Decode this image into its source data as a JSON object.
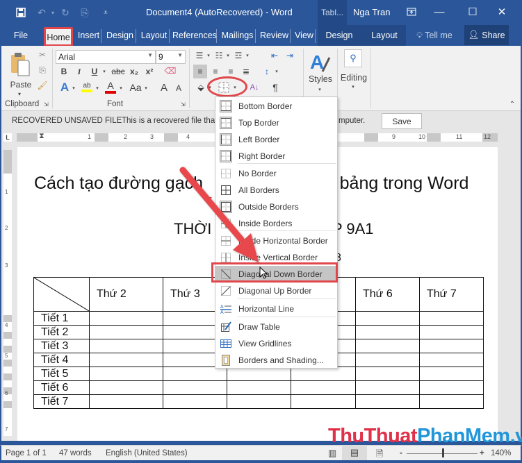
{
  "titlebar": {
    "title": "Document4 (AutoRecovered)  -  Word",
    "context_tab_title": "Tabl...",
    "user": "Nga Tran",
    "qat_icons": [
      "save-icon",
      "undo-icon",
      "redo-icon",
      "copy-icon",
      "customize-qat-icon"
    ],
    "window_buttons": [
      "ribbon-display-icon",
      "minimize-icon",
      "maximize-icon",
      "close-icon"
    ]
  },
  "tabs": {
    "items": [
      "File",
      "Home",
      "Insert",
      "Design",
      "Layout",
      "References",
      "Mailings",
      "Review",
      "View"
    ],
    "context_items": [
      "Design",
      "Layout"
    ],
    "tell_me": "Tell me",
    "share": "Share",
    "active": "Home"
  },
  "ribbon": {
    "clipboard": {
      "paste": "Paste",
      "label": "Clipboard"
    },
    "font": {
      "name": "Arial",
      "size": "9",
      "label": "Font",
      "bold": "B",
      "italic": "I",
      "underline": "U",
      "strike": "abc",
      "subscript": "x₂",
      "superscript": "x²",
      "change_case": "Aa",
      "grow": "A",
      "shrink": "A",
      "highlight_color": "#ffff00",
      "font_color": "#e00000"
    },
    "styles": {
      "label": "Styles"
    },
    "editing": {
      "label": "Editing"
    }
  },
  "message_bar": {
    "title": "RECOVERED UNSAVED FILE",
    "text_start": "This is a recovered file tha",
    "text_end": "mputer.",
    "save": "Save"
  },
  "ruler": {
    "labels": [
      "1",
      "2",
      "3",
      "4",
      "9",
      "10",
      "11",
      "12"
    ],
    "corner": "L",
    "vertical_labels": [
      "1",
      "2",
      "3",
      "4",
      "5",
      "6",
      "7"
    ]
  },
  "document": {
    "heading": "Cách tạo đường gạch                       qua bảng trong Word",
    "heading_left": "Cách tạo đường gạch",
    "heading_right": "qua bảng trong Word",
    "red_fragment": "T",
    "subheading_left": "THỜI",
    "subheading_right": "P 9A1",
    "line3_fragment": "8",
    "table": {
      "header": [
        "",
        "Thứ 2",
        "Thứ 3",
        "",
        "",
        "Thứ 6",
        "Thứ 7"
      ],
      "rows": [
        "Tiết 1",
        "Tiết 2",
        "Tiết 3",
        "Tiết 4",
        "Tiết 5",
        "Tiết 6",
        "Tiết 7"
      ]
    }
  },
  "borders_menu": {
    "items": [
      {
        "label": "Bottom Border",
        "icon": "bottom-border-icon",
        "active": true
      },
      {
        "label": "Top Border",
        "icon": "top-border-icon",
        "active": true
      },
      {
        "label": "Left Border",
        "icon": "left-border-icon",
        "active": true
      },
      {
        "label": "Right Border",
        "icon": "right-border-icon",
        "active": true
      },
      {
        "label": "No Border",
        "icon": "no-border-icon",
        "active": false
      },
      {
        "label": "All Borders",
        "icon": "all-borders-icon",
        "active": false
      },
      {
        "label": "Outside Borders",
        "icon": "outside-borders-icon",
        "active": true
      },
      {
        "label": "Inside Borders",
        "icon": "inside-borders-icon",
        "active": false
      },
      {
        "label": "Inside Horizontal Border",
        "icon": "inside-horizontal-border-icon",
        "active": false
      },
      {
        "label": "Inside Vertical Border",
        "icon": "inside-vertical-border-icon",
        "active": false
      },
      {
        "label": "Diagonal Down Border",
        "icon": "diagonal-down-border-icon",
        "active": false,
        "highlighted": true
      },
      {
        "label": "Diagonal Up Border",
        "icon": "diagonal-up-border-icon",
        "active": false
      },
      {
        "label": "Horizontal Line",
        "icon": "horizontal-line-icon",
        "active": false
      },
      {
        "label": "Draw Table",
        "icon": "draw-table-icon",
        "active": false
      },
      {
        "label": "View Gridlines",
        "icon": "view-gridlines-icon",
        "active": false
      },
      {
        "label": "Borders and Shading...",
        "icon": "borders-shading-icon",
        "active": false
      }
    ]
  },
  "status": {
    "page": "Page 1 of 1",
    "words": "47 words",
    "language": "English (United States)",
    "zoom": "140%",
    "zoom_minus": "-",
    "zoom_plus": "+"
  },
  "watermark": {
    "part1": "ThuThuat",
    "part2": "PhanMem",
    "part3": ".vn",
    "color1": "#e0304a",
    "color2": "#2196d8"
  },
  "colors": {
    "word_blue": "#2b579a",
    "annotation_red": "#e0464b"
  }
}
